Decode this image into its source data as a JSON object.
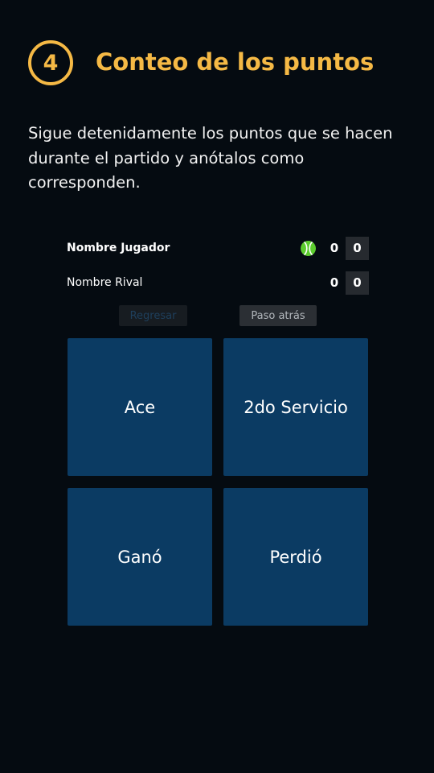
{
  "header": {
    "step_number": "4",
    "title": "Conteo de los puntos"
  },
  "description": "Sigue detenidamente los puntos que se hacen durante el partido y anótalos como corresponden.",
  "scoreboard": {
    "player": {
      "name": "Nombre Jugador",
      "games": "0",
      "points": "0",
      "serving": true
    },
    "rival": {
      "name": "Nombre Rival",
      "games": "0",
      "points": "0",
      "serving": false
    },
    "serve_icon": "tennis-ball-icon",
    "serve_color": "#5ccc2e"
  },
  "controls": {
    "back_label": "Regresar",
    "undo_label": "Paso atrás"
  },
  "actions": {
    "ace": "Ace",
    "second_serve": "2do Servicio",
    "won": "Ganó",
    "lost": "Perdió"
  },
  "colors": {
    "accent": "#f5b945",
    "background": "#050b11",
    "action_tile": "#0b3b63"
  }
}
